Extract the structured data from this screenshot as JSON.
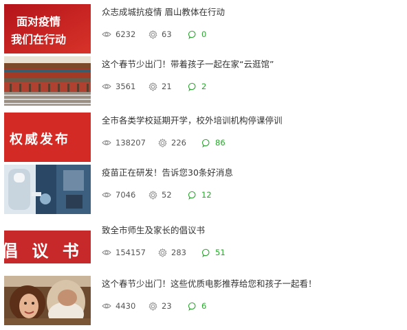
{
  "articles": [
    {
      "title": "众志成城抗疫情 眉山教体在行动",
      "views": "6232",
      "likes": "63",
      "comments": "0",
      "thumb_lines": [
        "面对疫情",
        "我们在行动"
      ]
    },
    {
      "title": "这个春节少出门！带着孩子一起在家“云逛馆”",
      "views": "3561",
      "likes": "21",
      "comments": "2"
    },
    {
      "title": "全市各类学校延期开学，校外培训机构停课停训",
      "views": "138207",
      "likes": "226",
      "comments": "86",
      "thumb_lines": [
        "权威发布"
      ]
    },
    {
      "title": "疫苗正在研发！告诉您30条好消息",
      "views": "7046",
      "likes": "52",
      "comments": "12"
    },
    {
      "title": "致全市师生及家长的倡议书",
      "views": "154157",
      "likes": "283",
      "comments": "51",
      "thumb_lines": [
        "倡 议 书"
      ]
    },
    {
      "title": "这个春节少出门！这些优质电影推荐给您和孩子一起看！",
      "views": "4430",
      "likes": "23",
      "comments": "6"
    }
  ],
  "colors": {
    "comment_green": "#2aa52e",
    "meta_gray": "#888888",
    "thumb_red": "#d42a26"
  },
  "icons": {
    "views": "eye-icon",
    "likes": "gear-like-icon",
    "comments": "speech-bubble-icon"
  }
}
